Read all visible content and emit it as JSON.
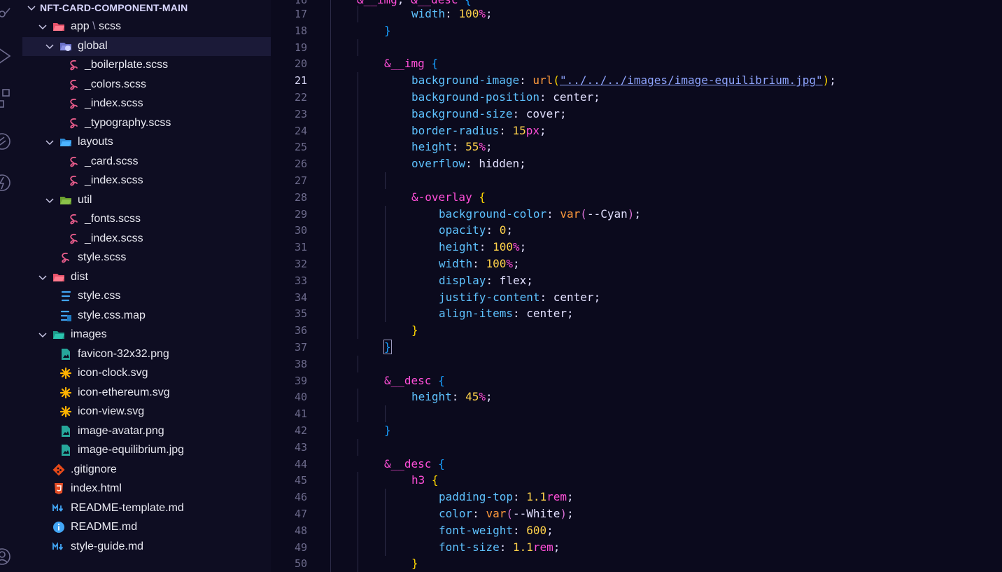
{
  "explorer": {
    "root": "NFT-CARD-COMPONENT-MAIN",
    "items": [
      {
        "label": "app",
        "label2": "scss",
        "sep": "\\",
        "depth": 1,
        "chevron": "down",
        "icon": "folder-red-open"
      },
      {
        "label": "global",
        "depth": 2,
        "chevron": "down",
        "icon": "folder-global-open",
        "selected": true
      },
      {
        "label": "_boilerplate.scss",
        "depth": 3,
        "icon": "sass"
      },
      {
        "label": "_colors.scss",
        "depth": 3,
        "icon": "sass"
      },
      {
        "label": "_index.scss",
        "depth": 3,
        "icon": "sass"
      },
      {
        "label": "_typography.scss",
        "depth": 3,
        "icon": "sass"
      },
      {
        "label": "layouts",
        "depth": 2,
        "chevron": "down",
        "icon": "folder-blue-open"
      },
      {
        "label": "_card.scss",
        "depth": 3,
        "icon": "sass"
      },
      {
        "label": "_index.scss",
        "depth": 3,
        "icon": "sass"
      },
      {
        "label": "util",
        "depth": 2,
        "chevron": "down",
        "icon": "folder-green-open"
      },
      {
        "label": "_fonts.scss",
        "depth": 3,
        "icon": "sass"
      },
      {
        "label": "_index.scss",
        "depth": 3,
        "icon": "sass"
      },
      {
        "label": "style.scss",
        "depth": 2,
        "icon": "sass"
      },
      {
        "label": "dist",
        "depth": 1,
        "chevron": "down",
        "icon": "folder-red-open"
      },
      {
        "label": "style.css",
        "depth": 2,
        "icon": "css"
      },
      {
        "label": "style.css.map",
        "depth": 2,
        "icon": "css-map"
      },
      {
        "label": "images",
        "depth": 1,
        "chevron": "down",
        "icon": "folder-teal-open"
      },
      {
        "label": "favicon-32x32.png",
        "depth": 2,
        "icon": "image"
      },
      {
        "label": "icon-clock.svg",
        "depth": 2,
        "icon": "svg"
      },
      {
        "label": "icon-ethereum.svg",
        "depth": 2,
        "icon": "svg"
      },
      {
        "label": "icon-view.svg",
        "depth": 2,
        "icon": "svg"
      },
      {
        "label": "image-avatar.png",
        "depth": 2,
        "icon": "image"
      },
      {
        "label": "image-equilibrium.jpg",
        "depth": 2,
        "icon": "image"
      },
      {
        "label": ".gitignore",
        "depth": 1,
        "icon": "git"
      },
      {
        "label": "index.html",
        "depth": 1,
        "icon": "html"
      },
      {
        "label": "README-template.md",
        "depth": 1,
        "icon": "markdown"
      },
      {
        "label": "README.md",
        "depth": 1,
        "icon": "info"
      },
      {
        "label": "style-guide.md",
        "depth": 1,
        "icon": "markdown"
      }
    ]
  },
  "editor": {
    "active_line": 21,
    "lines": [
      {
        "n": 17,
        "indent": 1,
        "tokens": [
          [
            "prop",
            "width"
          ],
          [
            "p",
            ": "
          ],
          [
            "num",
            "100"
          ],
          [
            "unit",
            "%"
          ],
          [
            "p",
            ";"
          ]
        ]
      },
      {
        "n": 18,
        "indent": 0,
        "tokens": [
          [
            "b3",
            "}"
          ]
        ]
      },
      {
        "n": 19,
        "indent": 0,
        "tokens": []
      },
      {
        "n": 20,
        "indent": 0,
        "tokens": [
          [
            "sel",
            "&__img"
          ],
          [
            "p",
            " "
          ],
          [
            "b3",
            "{"
          ]
        ]
      },
      {
        "n": 21,
        "indent": 1,
        "tokens": [
          [
            "prop",
            "background-image"
          ],
          [
            "p",
            ": "
          ],
          [
            "fn",
            "url"
          ],
          [
            "b1",
            "("
          ],
          [
            "str",
            "\"../../../images/image-equilibrium.jpg\""
          ],
          [
            "b1",
            ")"
          ],
          [
            "p",
            ";"
          ]
        ]
      },
      {
        "n": 22,
        "indent": 1,
        "tokens": [
          [
            "prop",
            "background-position"
          ],
          [
            "p",
            ": "
          ],
          [
            "val",
            "center"
          ],
          [
            "p",
            ";"
          ]
        ]
      },
      {
        "n": 23,
        "indent": 1,
        "tokens": [
          [
            "prop",
            "background-size"
          ],
          [
            "p",
            ": "
          ],
          [
            "val",
            "cover"
          ],
          [
            "p",
            ";"
          ]
        ]
      },
      {
        "n": 24,
        "indent": 1,
        "tokens": [
          [
            "prop",
            "border-radius"
          ],
          [
            "p",
            ": "
          ],
          [
            "num",
            "15"
          ],
          [
            "unit",
            "px"
          ],
          [
            "p",
            ";"
          ]
        ]
      },
      {
        "n": 25,
        "indent": 1,
        "tokens": [
          [
            "prop",
            "height"
          ],
          [
            "p",
            ": "
          ],
          [
            "num",
            "55"
          ],
          [
            "unit",
            "%"
          ],
          [
            "p",
            ";"
          ]
        ]
      },
      {
        "n": 26,
        "indent": 1,
        "tokens": [
          [
            "prop",
            "overflow"
          ],
          [
            "p",
            ": "
          ],
          [
            "val",
            "hidden"
          ],
          [
            "p",
            ";"
          ]
        ]
      },
      {
        "n": 27,
        "indent": 1,
        "tokens": []
      },
      {
        "n": 28,
        "indent": 1,
        "tokens": [
          [
            "sel",
            "&-overlay"
          ],
          [
            "p",
            " "
          ],
          [
            "b1",
            "{"
          ]
        ]
      },
      {
        "n": 29,
        "indent": 2,
        "tokens": [
          [
            "prop",
            "background-color"
          ],
          [
            "p",
            ": "
          ],
          [
            "fn",
            "var"
          ],
          [
            "b2",
            "("
          ],
          [
            "val",
            "--Cyan"
          ],
          [
            "b2",
            ")"
          ],
          [
            "p",
            ";"
          ]
        ]
      },
      {
        "n": 30,
        "indent": 2,
        "tokens": [
          [
            "prop",
            "opacity"
          ],
          [
            "p",
            ": "
          ],
          [
            "num",
            "0"
          ],
          [
            "p",
            ";"
          ]
        ]
      },
      {
        "n": 31,
        "indent": 2,
        "tokens": [
          [
            "prop",
            "height"
          ],
          [
            "p",
            ": "
          ],
          [
            "num",
            "100"
          ],
          [
            "unit",
            "%"
          ],
          [
            "p",
            ";"
          ]
        ]
      },
      {
        "n": 32,
        "indent": 2,
        "tokens": [
          [
            "prop",
            "width"
          ],
          [
            "p",
            ": "
          ],
          [
            "num",
            "100"
          ],
          [
            "unit",
            "%"
          ],
          [
            "p",
            ";"
          ]
        ]
      },
      {
        "n": 33,
        "indent": 2,
        "tokens": [
          [
            "prop",
            "display"
          ],
          [
            "p",
            ": "
          ],
          [
            "val",
            "flex"
          ],
          [
            "p",
            ";"
          ]
        ]
      },
      {
        "n": 34,
        "indent": 2,
        "tokens": [
          [
            "prop",
            "justify-content"
          ],
          [
            "p",
            ": "
          ],
          [
            "val",
            "center"
          ],
          [
            "p",
            ";"
          ]
        ]
      },
      {
        "n": 35,
        "indent": 2,
        "tokens": [
          [
            "prop",
            "align-items"
          ],
          [
            "p",
            ": "
          ],
          [
            "val",
            "center"
          ],
          [
            "p",
            ";"
          ]
        ]
      },
      {
        "n": 36,
        "indent": 1,
        "tokens": [
          [
            "b1",
            "}"
          ]
        ]
      },
      {
        "n": 37,
        "indent": 0,
        "tokens": [
          [
            "b3box",
            "}"
          ]
        ]
      },
      {
        "n": 38,
        "indent": 0,
        "tokens": []
      },
      {
        "n": 39,
        "indent": 0,
        "tokens": [
          [
            "sel",
            "&__desc"
          ],
          [
            "p",
            " "
          ],
          [
            "b3",
            "{"
          ]
        ]
      },
      {
        "n": 40,
        "indent": 1,
        "tokens": [
          [
            "prop",
            "height"
          ],
          [
            "p",
            ": "
          ],
          [
            "num",
            "45"
          ],
          [
            "unit",
            "%"
          ],
          [
            "p",
            ";"
          ]
        ]
      },
      {
        "n": 41,
        "indent": 1,
        "tokens": []
      },
      {
        "n": 42,
        "indent": 0,
        "tokens": [
          [
            "b3",
            "}"
          ]
        ]
      },
      {
        "n": 43,
        "indent": 0,
        "tokens": []
      },
      {
        "n": 44,
        "indent": 0,
        "tokens": [
          [
            "sel",
            "&__desc"
          ],
          [
            "p",
            " "
          ],
          [
            "b3",
            "{"
          ]
        ]
      },
      {
        "n": 45,
        "indent": 1,
        "tokens": [
          [
            "sel",
            "h3"
          ],
          [
            "p",
            " "
          ],
          [
            "b1",
            "{"
          ]
        ]
      },
      {
        "n": 46,
        "indent": 2,
        "tokens": [
          [
            "prop",
            "padding-top"
          ],
          [
            "p",
            ": "
          ],
          [
            "num",
            "1.1"
          ],
          [
            "unit",
            "rem"
          ],
          [
            "p",
            ";"
          ]
        ]
      },
      {
        "n": 47,
        "indent": 2,
        "tokens": [
          [
            "prop",
            "color"
          ],
          [
            "p",
            ": "
          ],
          [
            "fn",
            "var"
          ],
          [
            "b2",
            "("
          ],
          [
            "val",
            "--White"
          ],
          [
            "b2",
            ")"
          ],
          [
            "p",
            ";"
          ]
        ]
      },
      {
        "n": 48,
        "indent": 2,
        "tokens": [
          [
            "prop",
            "font-weight"
          ],
          [
            "p",
            ": "
          ],
          [
            "num",
            "600"
          ],
          [
            "p",
            ";"
          ]
        ]
      },
      {
        "n": 49,
        "indent": 2,
        "tokens": [
          [
            "prop",
            "font-size"
          ],
          [
            "p",
            ": "
          ],
          [
            "num",
            "1.1"
          ],
          [
            "unit",
            "rem"
          ],
          [
            "p",
            ";"
          ]
        ]
      },
      {
        "n": 50,
        "indent": 1,
        "tokens": [
          [
            "b1",
            "}"
          ]
        ]
      }
    ]
  },
  "activity_bar": [
    "source-control-icon",
    "run-debug-icon",
    "extensions-icon",
    "remote-explorer-icon",
    "lightning-icon",
    "account-icon"
  ]
}
